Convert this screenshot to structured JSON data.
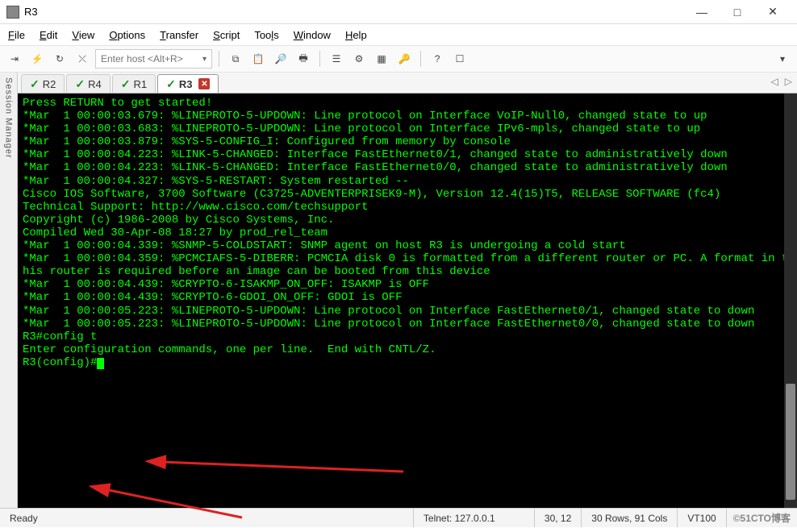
{
  "window": {
    "title": "R3",
    "minimize": "—",
    "maximize": "□",
    "close": "✕"
  },
  "menu": {
    "file": "File",
    "edit": "Edit",
    "view": "View",
    "options": "Options",
    "transfer": "Transfer",
    "script": "Script",
    "tools": "Tools",
    "window": "Window",
    "help": "Help"
  },
  "toolbar": {
    "host_placeholder": "Enter host <Alt+R>"
  },
  "sidebar": {
    "label": "Session Manager"
  },
  "tabs": [
    {
      "label": "R2",
      "active": false
    },
    {
      "label": "R4",
      "active": false
    },
    {
      "label": "R1",
      "active": false
    },
    {
      "label": "R3",
      "active": true
    }
  ],
  "tab_nav": {
    "left": "◁",
    "right": "▷"
  },
  "terminal_lines": [
    "Press RETURN to get started!",
    "",
    "",
    "*Mar  1 00:00:03.679: %LINEPROTO-5-UPDOWN: Line protocol on Interface VoIP-Null0, changed state to up",
    "*Mar  1 00:00:03.683: %LINEPROTO-5-UPDOWN: Line protocol on Interface IPv6-mpls, changed state to up",
    "*Mar  1 00:00:03.879: %SYS-5-CONFIG_I: Configured from memory by console",
    "*Mar  1 00:00:04.223: %LINK-5-CHANGED: Interface FastEthernet0/1, changed state to administratively down",
    "*Mar  1 00:00:04.223: %LINK-5-CHANGED: Interface FastEthernet0/0, changed state to administratively down",
    "*Mar  1 00:00:04.327: %SYS-5-RESTART: System restarted --",
    "Cisco IOS Software, 3700 Software (C3725-ADVENTERPRISEK9-M), Version 12.4(15)T5, RELEASE SOFTWARE (fc4)",
    "Technical Support: http://www.cisco.com/techsupport",
    "Copyright (c) 1986-2008 by Cisco Systems, Inc.",
    "Compiled Wed 30-Apr-08 18:27 by prod_rel_team",
    "*Mar  1 00:00:04.339: %SNMP-5-COLDSTART: SNMP agent on host R3 is undergoing a cold start",
    "*Mar  1 00:00:04.359: %PCMCIAFS-5-DIBERR: PCMCIA disk 0 is formatted from a different router or PC. A format in this router is required before an image can be booted from this device",
    "*Mar  1 00:00:04.439: %CRYPTO-6-ISAKMP_ON_OFF: ISAKMP is OFF",
    "*Mar  1 00:00:04.439: %CRYPTO-6-GDOI_ON_OFF: GDOI is OFF",
    "*Mar  1 00:00:05.223: %LINEPROTO-5-UPDOWN: Line protocol on Interface FastEthernet0/1, changed state to down",
    "*Mar  1 00:00:05.223: %LINEPROTO-5-UPDOWN: Line protocol on Interface FastEthernet0/0, changed state to down",
    "R3#config t",
    "Enter configuration commands, one per line.  End with CNTL/Z.",
    "R3(config)#"
  ],
  "status": {
    "ready": "Ready",
    "conn": "Telnet: 127.0.0.1",
    "pos": "30, 12",
    "size": "30 Rows, 91 Cols",
    "term": "VT100",
    "watermark": "©51CTO博客"
  }
}
